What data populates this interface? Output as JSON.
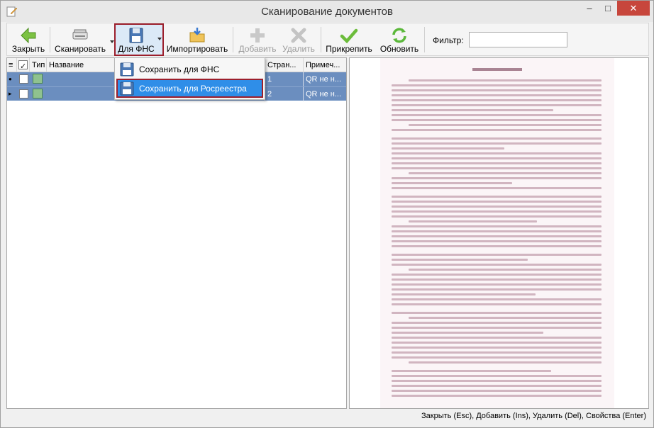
{
  "window": {
    "title": "Сканирование документов",
    "minimize": "‒",
    "maximize": "□",
    "close": "✕"
  },
  "toolbar": {
    "close_label": "Закрыть",
    "scan_label": "Сканировать",
    "fns_label": "Для ФНС",
    "import_label": "Импортировать",
    "add_label": "Добавить",
    "delete_label": "Удалить",
    "attach_label": "Прикрепить",
    "refresh_label": "Обновить",
    "filter_label": "Фильтр:",
    "filter_value": ""
  },
  "dropdown_menu": {
    "items": [
      {
        "label": "Сохранить для ФНС"
      },
      {
        "label": "Сохранить для Росреестра"
      }
    ]
  },
  "grid": {
    "columns": [
      {
        "label": "Тип"
      },
      {
        "label": "Название"
      },
      {
        "label": "Стран..."
      },
      {
        "label": "Примеч..."
      }
    ],
    "rows": [
      {
        "name": "",
        "pages": "1",
        "note": "QR не н..."
      },
      {
        "name": "",
        "pages": "2",
        "note": "QR не н..."
      }
    ]
  },
  "statusbar": {
    "hint": "Закрыть (Esc), Добавить (Ins), Удалить (Del), Свойства (Enter)"
  },
  "colors": {
    "selection": "#6b8ebf",
    "menu_hover": "#2f8ee8",
    "highlight_border": "#9c1f2c",
    "close_button": "#c7463c"
  }
}
